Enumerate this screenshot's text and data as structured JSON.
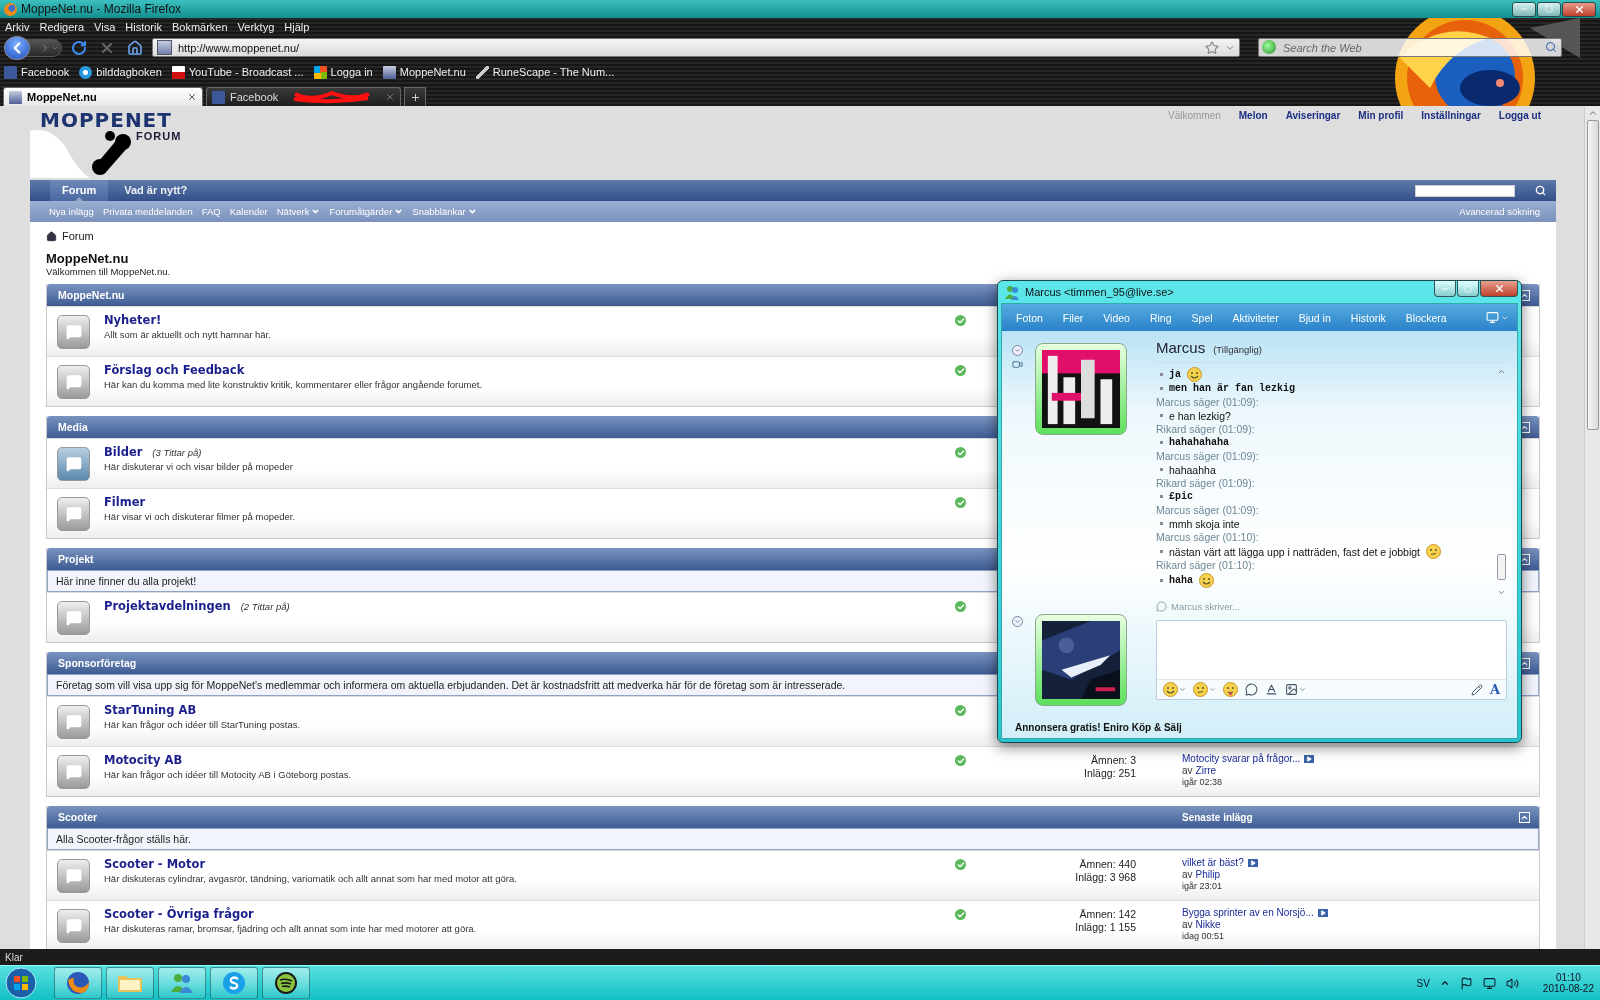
{
  "browser": {
    "title": "MoppeNet.nu - Mozilla Firefox",
    "menu": [
      "Arkiv",
      "Redigera",
      "Visa",
      "Historik",
      "Bokmärken",
      "Verktyg",
      "Hjälp"
    ],
    "url": "http://www.moppenet.nu/",
    "search": {
      "placeholder": "Search the Web"
    },
    "bookmarks": [
      "Facebook",
      "bilddagboken",
      "YouTube - Broadcast ...",
      "Logga in",
      "MoppeNet.nu",
      "RuneScape - The Num..."
    ],
    "tabs": [
      {
        "label": "MoppeNet.nu",
        "selected": true,
        "redacted": false
      },
      {
        "label": "Facebook",
        "selected": false,
        "redacted": true
      }
    ],
    "status": "Klar"
  },
  "forum": {
    "logo": {
      "title": "MOPPENET",
      "subtitle": "FORUM"
    },
    "user_links": [
      {
        "label": "Välkommen",
        "kind": "text"
      },
      {
        "label": "Melon",
        "kind": "link"
      },
      {
        "label": "Aviseringar",
        "kind": "link"
      },
      {
        "label": "Min profil",
        "kind": "link"
      },
      {
        "label": "Inställningar",
        "kind": "link"
      },
      {
        "label": "Logga ut",
        "kind": "link"
      }
    ],
    "nav_tabs": [
      {
        "label": "Forum",
        "selected": true
      },
      {
        "label": "Vad är nytt?",
        "selected": false
      }
    ],
    "sub_nav": [
      {
        "label": "Nya inlägg",
        "dropdown": false
      },
      {
        "label": "Privata meddelanden",
        "dropdown": false
      },
      {
        "label": "FAQ",
        "dropdown": false
      },
      {
        "label": "Kalender",
        "dropdown": false
      },
      {
        "label": "Nätverk",
        "dropdown": true
      },
      {
        "label": "Forumåtgärder",
        "dropdown": true
      },
      {
        "label": "Snabblänkar",
        "dropdown": true
      }
    ],
    "advanced_search": "Avancerad sökning",
    "breadcrumb": "Forum",
    "title": "MoppeNet.nu",
    "subtitle": "Välkommen till MoppeNet.nu.",
    "sections": [
      {
        "title": "MoppeNet.nu",
        "forums": [
          {
            "name": "Nyheter!",
            "description": "Allt som är aktuellt och nytt hamnar här.",
            "new": false
          },
          {
            "name": "Förslag och Feedback",
            "description": "Här kan du komma med lite konstruktiv kritik, kommentarer eller frågor angående forumet.",
            "new": false
          }
        ]
      },
      {
        "title": "Media",
        "forums": [
          {
            "name": "Bilder",
            "viewers": "(3 Tittar på)",
            "description": "Här diskuterar vi och visar bilder på mopeder",
            "new": true
          },
          {
            "name": "Filmer",
            "description": "Här visar vi och diskuterar filmer på mopeder.",
            "new": false
          }
        ]
      },
      {
        "title": "Projekt",
        "description": "Här inne finner du alla projekt!",
        "forums": [
          {
            "name": "Projektavdelningen",
            "viewers": "(2 Tittar på)",
            "new": false
          }
        ]
      },
      {
        "title": "Sponsorföretag",
        "description": "Företag som vill visa upp sig för MoppeNet's medlemmar och informera om aktuella erbjudanden. Det är kostnadsfritt att medverka här för de företag som är intresserade.",
        "forums": [
          {
            "name": "StarTuning AB",
            "description": "Här kan frågor och idéer till StarTuning postas.",
            "new": false
          },
          {
            "name": "Motocity AB",
            "description": "Här kan frågor och idéer till Motocity AB i Göteborg postas.",
            "new": false,
            "stats": {
              "topics": "Ämnen: 3",
              "posts": "Inlägg: 251"
            },
            "last_post": {
              "title": "Motocity svarar på frågor...",
              "by": "av",
              "author": "Zirre",
              "time": "igår 02:38"
            }
          }
        ]
      },
      {
        "title": "Scooter",
        "column_header": "Senaste inlägg",
        "description": "Alla Scooter-frågor ställs här.",
        "forums": [
          {
            "name": "Scooter - Motor",
            "description": "Här diskuteras cylindrar, avgasrör, tändning, variomatik och allt annat som har med motor att göra.",
            "new": false,
            "stats": {
              "topics": "Ämnen: 440",
              "posts": "Inlägg: 3 968"
            },
            "last_post": {
              "title": "vilket är bäst?",
              "by": "av",
              "author": "Philip",
              "time": "igår 23:01"
            }
          },
          {
            "name": "Scooter - Övriga frågor",
            "description": "Här diskuteras ramar, bromsar, fjädring och allt annat som inte har med motorer att göra.",
            "new": false,
            "stats": {
              "topics": "Ämnen: 142",
              "posts": "Inlägg: 1 155"
            },
            "last_post": {
              "title": "Bygga sprinter av en Norsjö...",
              "by": "av",
              "author": "Nikke",
              "time": "idag 00:51"
            }
          }
        ]
      }
    ]
  },
  "messenger": {
    "title": "Marcus <timmen_95@live.se>",
    "menu": [
      "Foton",
      "Filer",
      "Video",
      "Ring",
      "Spel",
      "Aktiviteter",
      "Bjud in",
      "Historik",
      "Blockera"
    ],
    "contact": {
      "name": "Marcus",
      "status": "(Tillgänglig)"
    },
    "conversation": [
      {
        "kind": "outgoing",
        "text": "ja",
        "emoticon": true
      },
      {
        "kind": "outgoing",
        "text": "men han är fan lezkig"
      },
      {
        "kind": "sender",
        "text": "Marcus säger (01:09):"
      },
      {
        "kind": "incoming",
        "text": "e han lezkig?"
      },
      {
        "kind": "sender",
        "text": "Rikard säger (01:09):"
      },
      {
        "kind": "outgoing",
        "text": "hahahahaha"
      },
      {
        "kind": "sender",
        "text": "Marcus säger (01:09):"
      },
      {
        "kind": "incoming",
        "text": "hahaahha"
      },
      {
        "kind": "sender",
        "text": "Rikard säger (01:09):"
      },
      {
        "kind": "outgoing",
        "text": "£pic"
      },
      {
        "kind": "sender",
        "text": "Marcus säger (01:09):"
      },
      {
        "kind": "incoming",
        "text": "mmh skoja inte"
      },
      {
        "kind": "sender",
        "text": "Marcus säger (01:10):"
      },
      {
        "kind": "incoming",
        "text": "nästan värt att lägga upp i natträden, fast det e jobbigt",
        "emoticon": true
      },
      {
        "kind": "sender",
        "text": "Rikard säger (01:10):"
      },
      {
        "kind": "outgoing",
        "text": "haha",
        "emoticon": true
      }
    ],
    "typing": "Marcus skriver...",
    "font_button": "A",
    "ad": "Annonsera gratis! Eniro Köp & Sälj"
  },
  "taskbar": {
    "language": "SV",
    "time": "01:10",
    "date": "2010-08-22"
  }
}
